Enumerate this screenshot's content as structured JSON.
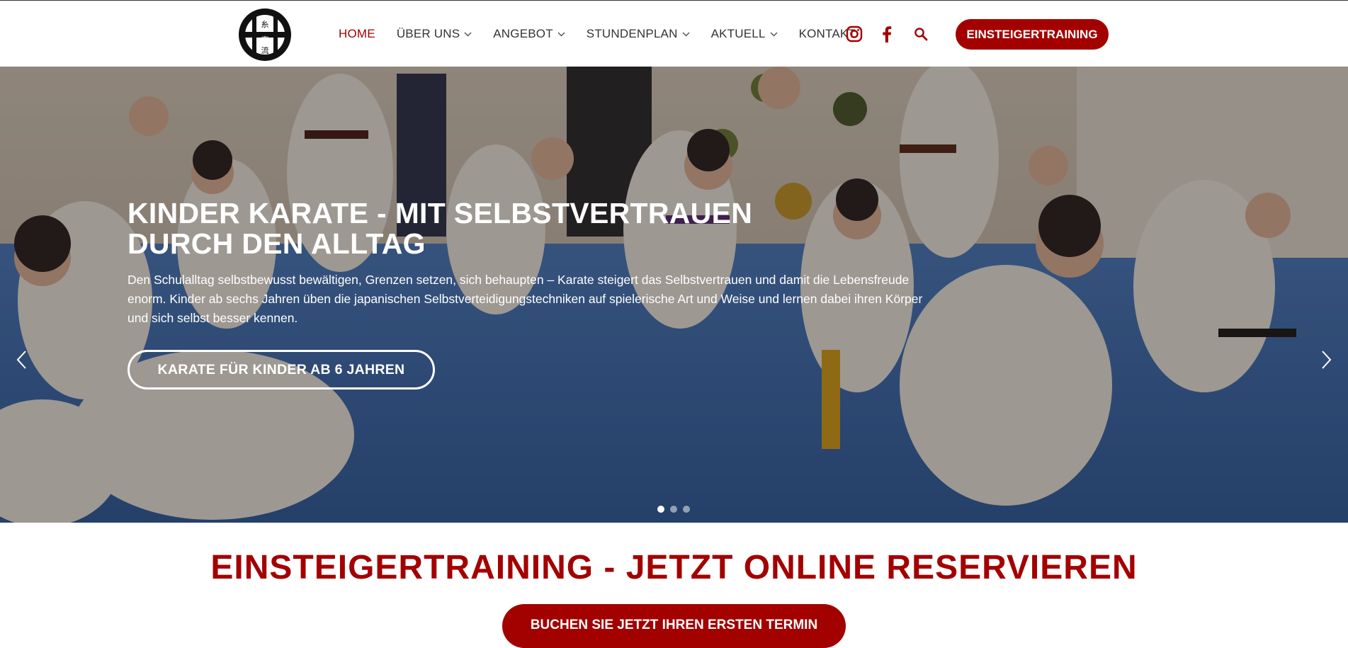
{
  "header": {
    "logo_name": "shito-ryu-emblem",
    "nav": [
      {
        "label": "HOME",
        "active": true,
        "dropdown": false
      },
      {
        "label": "ÜBER UNS",
        "active": false,
        "dropdown": true
      },
      {
        "label": "ANGEBOT",
        "active": false,
        "dropdown": true
      },
      {
        "label": "STUNDENPLAN",
        "active": false,
        "dropdown": true
      },
      {
        "label": "AKTUELL",
        "active": false,
        "dropdown": true
      },
      {
        "label": "KONTAKT",
        "active": false,
        "dropdown": false
      }
    ],
    "icons": [
      "instagram-icon",
      "facebook-icon",
      "search-icon"
    ],
    "cta_label": "EINSTEIGERTRAINING"
  },
  "hero": {
    "title": "KINDER KARATE - MIT SELBSTVERTRAUEN DURCH DEN ALLTAG",
    "text": "Den Schulalltag selbstbewusst bewältigen, Grenzen setzen, sich behaupten – Karate steigert das Selbstvertrauen und damit die Lebensfreude enorm. Kinder ab sechs Jahren üben die japanischen Selbstverteidigungstechniken auf spielerische Art und Weise und lernen dabei ihren Körper und sich selbst besser kennen.",
    "button_label": "KARATE FÜR KINDER AB 6 JAHREN",
    "slide_count": 3,
    "active_slide": 1
  },
  "promo": {
    "title": "EINSTEIGERTRAINING - JETZT ONLINE RESERVIEREN",
    "button_label": "BUCHEN SIE JETZT IHREN ERSTEN TERMIN"
  },
  "colors": {
    "accent": "#a30000",
    "nav_text": "#333333",
    "mat_blue": "#3b6fb8",
    "gi_white": "#f3efe8",
    "wall": "#e9e2d6"
  }
}
